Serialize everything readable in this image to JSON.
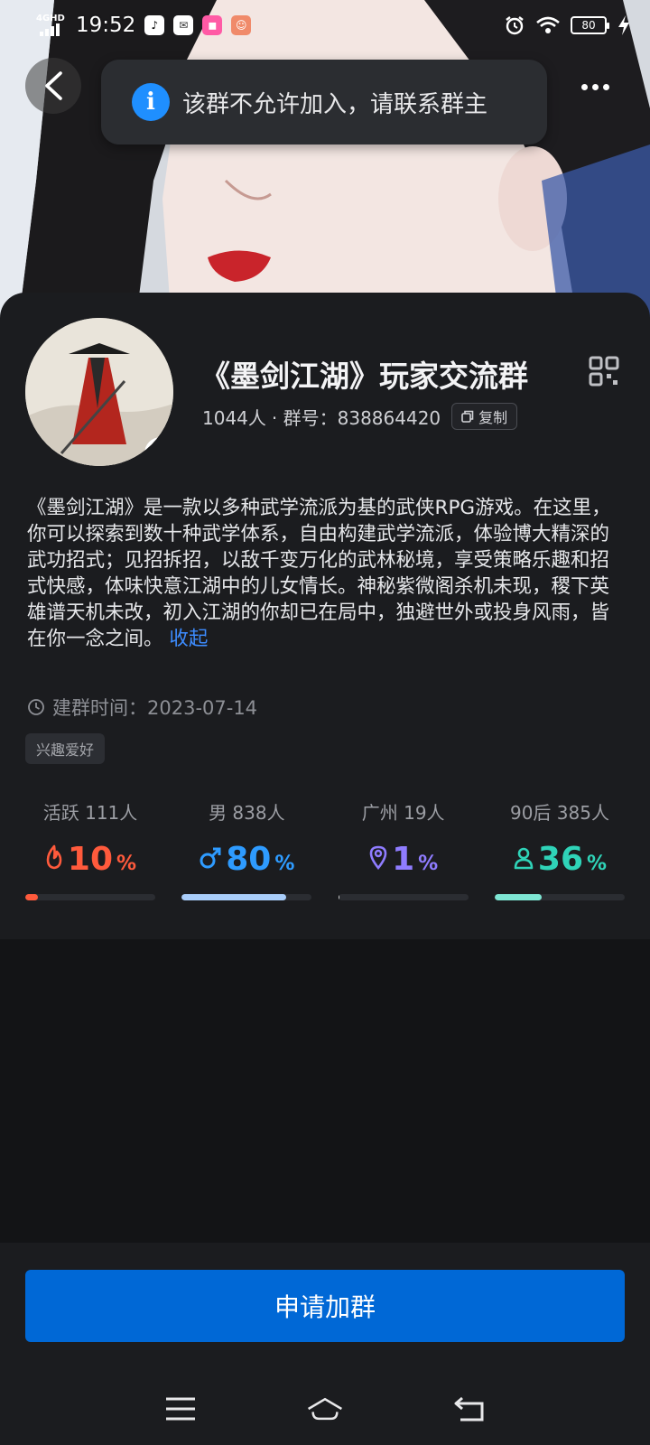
{
  "status_bar": {
    "network": "4GHD",
    "time": "19:52",
    "battery": "80"
  },
  "toast": {
    "icon": "info-icon",
    "message": "该群不允许加入，请联系群主"
  },
  "group": {
    "name": "《墨剑江湖》玩家交流群",
    "member_count": "1044人",
    "id_label": "·  群号：838864420",
    "copy_label": "复制",
    "description": "《墨剑江湖》是一款以多种武学流派为基的武侠RPG游戏。在这里，你可以探索到数十种武学体系，自由构建武学流派，体验博大精深的武功招式；见招拆招，以敌千变万化的武林秘境，享受策略乐趣和招式快感，体味快意江湖中的儿女情长。神秘紫微阁杀机未现，稷下英雄谱天机未改，初入江湖的你却已在局中，独避世外或投身风雨，皆在你一念之间。",
    "collapse_label": "收起",
    "created": "建群时间：2023-07-14",
    "tag": "兴趣爱好"
  },
  "stats": [
    {
      "label": "活跃 111人",
      "value": "10",
      "unit": "%",
      "percent": 10,
      "color": "#ff5a3c",
      "icon": "flame-icon"
    },
    {
      "label": "男 838人",
      "value": "80",
      "unit": "%",
      "percent": 80,
      "color": "#2e9bff",
      "bar_color": "#a9cdfa",
      "icon": "male-icon"
    },
    {
      "label": "广州 19人",
      "value": "1",
      "unit": "%",
      "percent": 1,
      "color": "#8f7cff",
      "bar_color": "#d6d6d6",
      "icon": "location-pin-icon"
    },
    {
      "label": "90后 385人",
      "value": "36",
      "unit": "%",
      "percent": 36,
      "color": "#2fd3b8",
      "bar_color": "#7ee6d3",
      "icon": "person-icon"
    }
  ],
  "actions": {
    "join_label": "申请加群"
  }
}
